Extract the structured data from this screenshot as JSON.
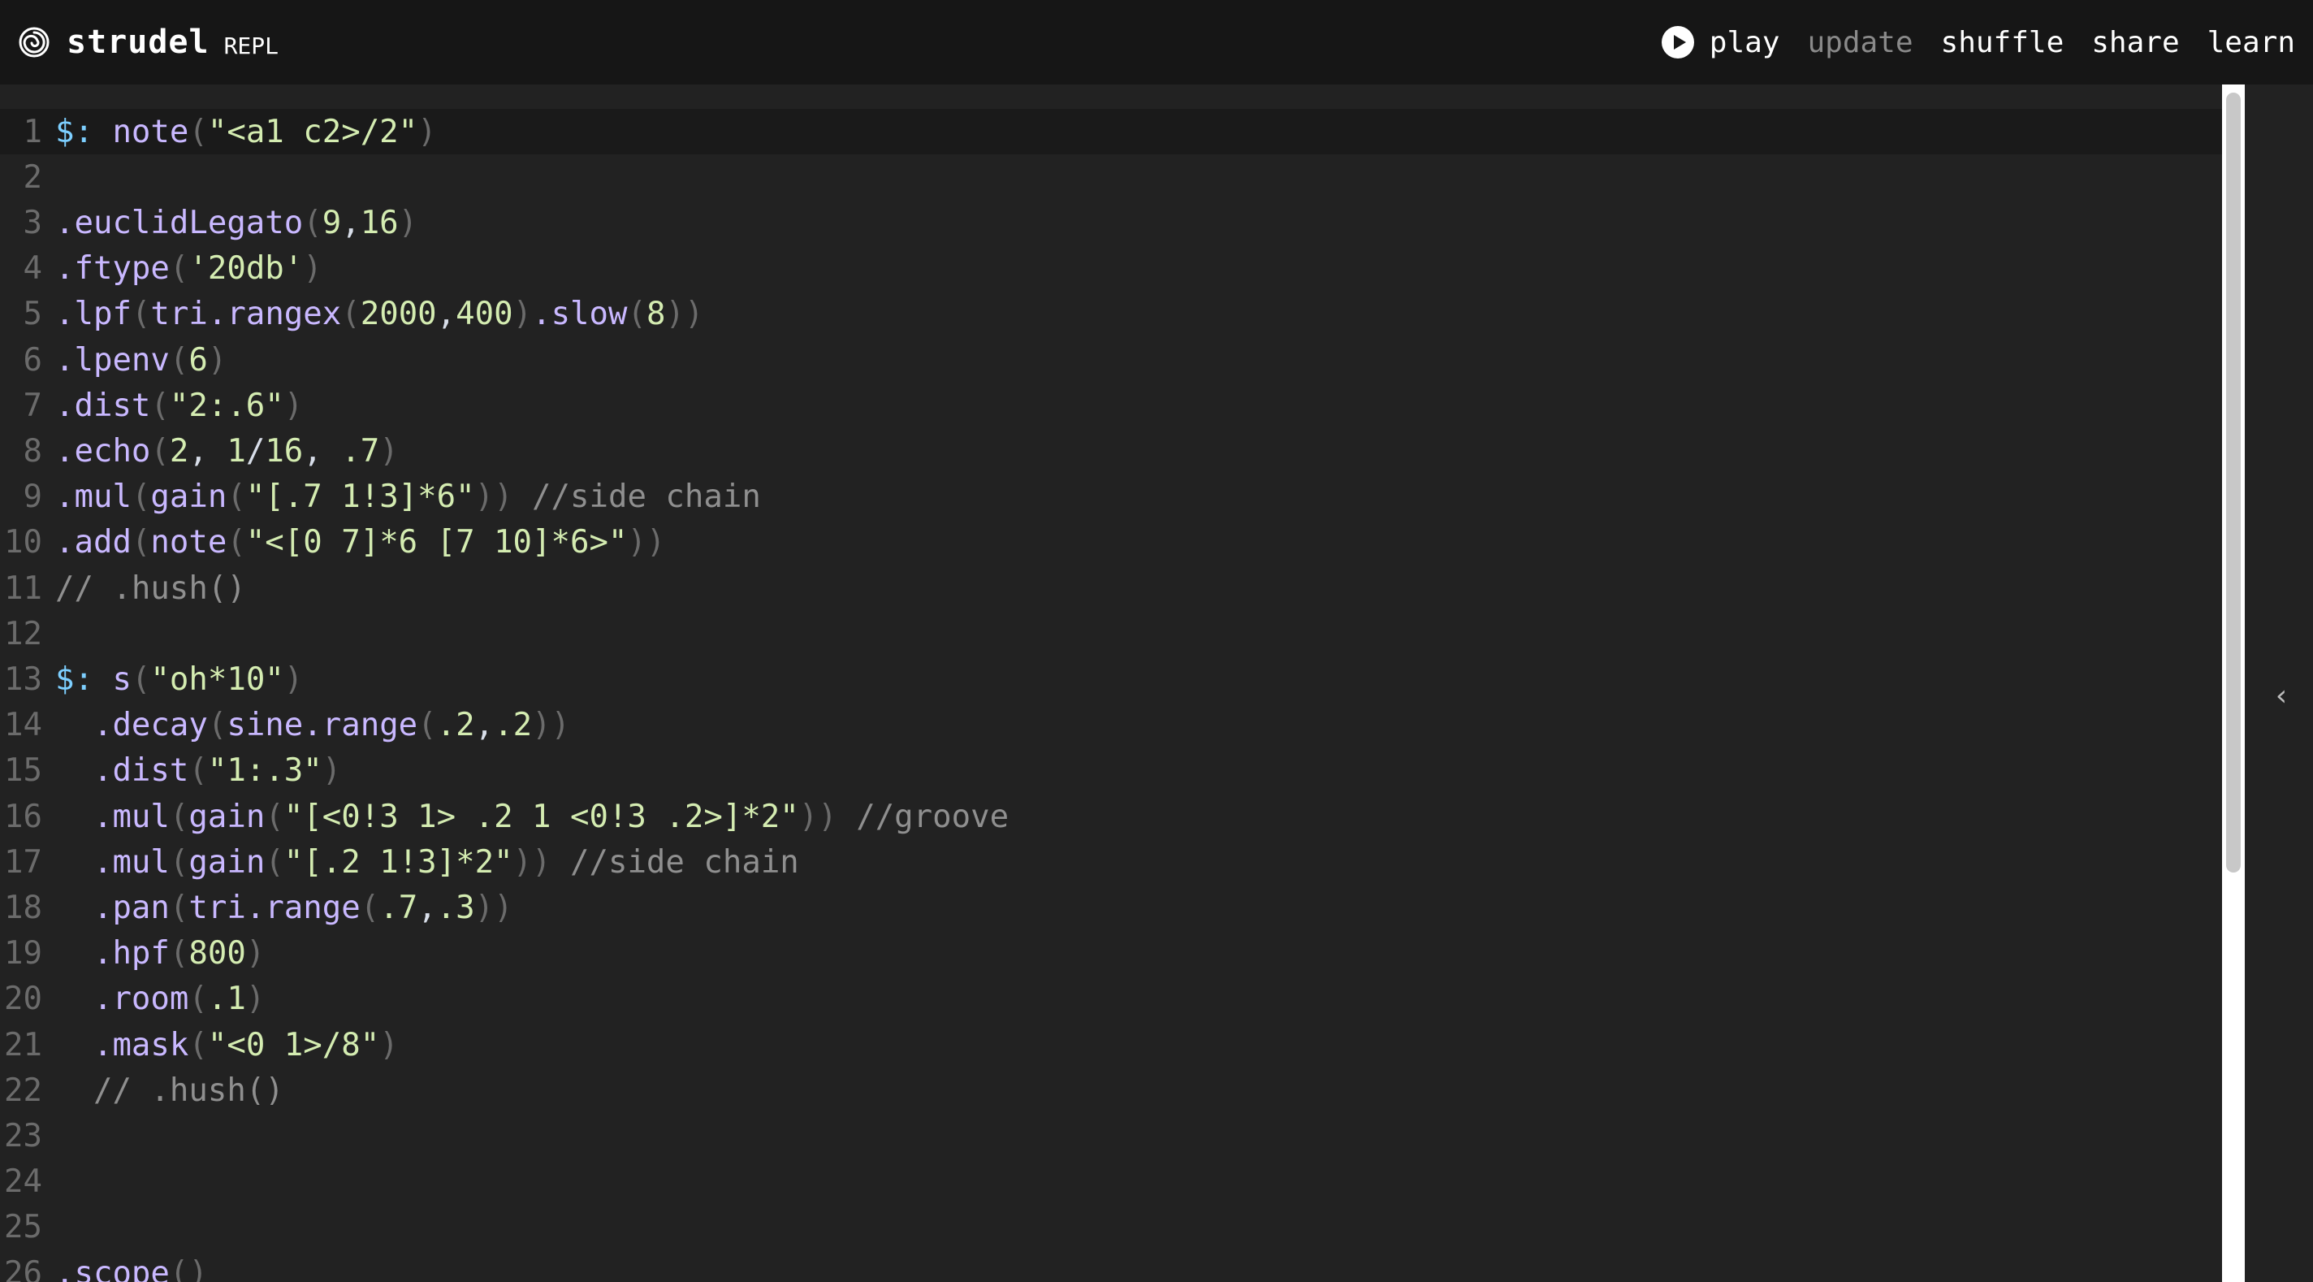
{
  "header": {
    "title": "strudel",
    "subtitle": "REPL",
    "logo_icon": "spiral-icon",
    "nav": {
      "play": "play",
      "update": "update",
      "shuffle": "shuffle",
      "share": "share",
      "learn": "learn"
    }
  },
  "editor": {
    "active_line": 1,
    "lines": [
      {
        "n": "1",
        "text": "$: note(\"<a1 c2>/2\")"
      },
      {
        "n": "2",
        "text": ""
      },
      {
        "n": "3",
        "text": ".euclidLegato(9,16)"
      },
      {
        "n": "4",
        "text": ".ftype('20db')"
      },
      {
        "n": "5",
        "text": ".lpf(tri.rangex(2000,400).slow(8))"
      },
      {
        "n": "6",
        "text": ".lpenv(6)"
      },
      {
        "n": "7",
        "text": ".dist(\"2:.6\")"
      },
      {
        "n": "8",
        "text": ".echo(2, 1/16, .7)"
      },
      {
        "n": "9",
        "text": ".mul(gain(\"[.7 1!3]*6\")) //side chain"
      },
      {
        "n": "10",
        "text": ".add(note(\"<[0 7]*6 [7 10]*6>\"))"
      },
      {
        "n": "11",
        "text": "// .hush()"
      },
      {
        "n": "12",
        "text": ""
      },
      {
        "n": "13",
        "text": "$: s(\"oh*10\")"
      },
      {
        "n": "14",
        "text": "  .decay(sine.range(.2,.2))"
      },
      {
        "n": "15",
        "text": "  .dist(\"1:.3\")"
      },
      {
        "n": "16",
        "text": "  .mul(gain(\"[<0!3 1> .2 1 <0!3 .2>]*2\")) //groove"
      },
      {
        "n": "17",
        "text": "  .mul(gain(\"[.2 1!3]*2\")) //side chain"
      },
      {
        "n": "18",
        "text": "  .pan(tri.range(.7,.3))"
      },
      {
        "n": "19",
        "text": "  .hpf(800)"
      },
      {
        "n": "20",
        "text": "  .room(.1)"
      },
      {
        "n": "21",
        "text": "  .mask(\"<0 1>/8\")"
      },
      {
        "n": "22",
        "text": "  // .hush()"
      },
      {
        "n": "23",
        "text": ""
      },
      {
        "n": "24",
        "text": ""
      },
      {
        "n": "25",
        "text": ""
      },
      {
        "n": "26",
        "text": ".scope()"
      }
    ]
  },
  "side_panel": {
    "toggle_icon": "chevron-left-icon",
    "toggle_glyph": "‹"
  },
  "colors": {
    "background": "#222222",
    "header": "#161616",
    "string": "#d4ecb1",
    "method": "#c9b8ff",
    "keyword": "#7dcfff",
    "comment": "#8f8f8f"
  }
}
